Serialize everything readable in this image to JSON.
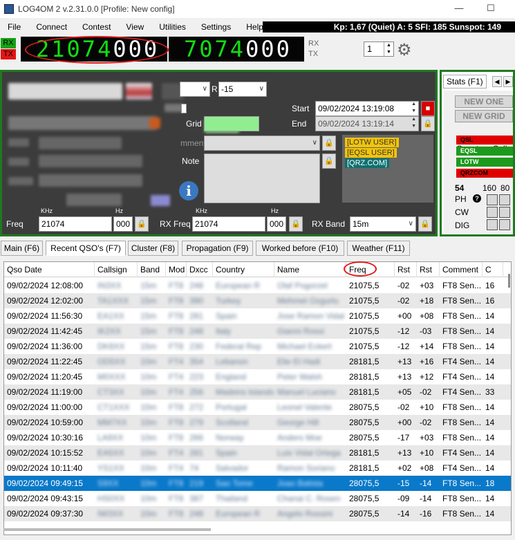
{
  "window": {
    "title": "LOG4OM 2 v.2.31.0.0 [Profile: New config]",
    "minimize": "—",
    "maximize": "☐"
  },
  "menu": [
    "File",
    "Connect",
    "Contest",
    "View",
    "Utilities",
    "Settings",
    "Help"
  ],
  "status_strip": "Kp: 1,67 (Quiet)  A: 5  SFI: 185 Sunspot: 149",
  "freq_display": {
    "rx_label": "RX",
    "tx_label": "TX",
    "main_digits": "21074",
    "main_small": "000",
    "main_ghost": "8.888.",
    "second_digits": "7074",
    "second_small": "000",
    "rx_side": "RX",
    "tx_side": "TX",
    "spinner_value": "1"
  },
  "qso": {
    "r_label": "R",
    "r_value": "-15",
    "start_label": "Start",
    "start_value": "09/02/2024 13:19:08",
    "end_label": "End",
    "end_value": "09/02/2024 13:19:14",
    "grid_label": "Grid",
    "comment_label": "mment",
    "note_label": "Note",
    "tags": [
      "[LOTW USER]",
      "[EQSL USER]",
      "[QRZ.COM]"
    ],
    "khz_label": "KHz",
    "hz_label": "Hz",
    "freq_label": "Freq",
    "freq_khz": "21074",
    "freq_hz": "000",
    "rxfreq_label": "RX Freq",
    "rxfreq_khz": "21074",
    "rxfreq_hz": "000",
    "rxband_label": "RX Band",
    "rxband_value": "15m",
    "info_icon_glyph": "i",
    "lock_glyph": "🔒"
  },
  "stats": {
    "tab_label": "Stats (F1)",
    "new_one": "NEW ONE",
    "new_grid": "NEW GRID",
    "country_call": "Country - Call",
    "rows": [
      {
        "label": "QSL",
        "color": "#e00000"
      },
      {
        "label": "EQSL",
        "color": "#1d9a1d"
      },
      {
        "label": "LOTW",
        "color": "#1d9a1d"
      },
      {
        "label": "QRZCOM",
        "color": "#e00000"
      }
    ],
    "count1": "54",
    "count2": "160",
    "count3": "80",
    "help_glyph": "?",
    "modes": [
      "PH",
      "CW",
      "DIG"
    ]
  },
  "tabs": [
    "Main (F6)",
    "Recent QSO's (F7)",
    "Cluster (F8)",
    "Propagation (F9)",
    "Worked before (F10)",
    "Weather (F11)"
  ],
  "grid": {
    "columns": [
      "Qso Date",
      "Callsign",
      "Band",
      "Mod",
      "Dxcc",
      "Country",
      "Name",
      "Freq",
      "Rst",
      "Rst",
      "Comment",
      "C"
    ],
    "rows": [
      {
        "date": "09/02/2024 12:08:00",
        "call": "IN3XX",
        "band": "15m",
        "mode": "FT8",
        "dxcc": "248",
        "country": "European R",
        "name": "Olaf Pogorzel",
        "freq": "21075,5",
        "rst_s": "-02",
        "rst_r": "+03",
        "comment": "FT8  Sen...",
        "c": "16"
      },
      {
        "date": "09/02/2024 12:02:00",
        "call": "TA1XXX",
        "band": "15m",
        "mode": "FT8",
        "dxcc": "390",
        "country": "Turkey",
        "name": "Mehmet Ozgurlu",
        "freq": "21075,5",
        "rst_s": "-02",
        "rst_r": "+18",
        "comment": "FT8  Sen...",
        "c": "16"
      },
      {
        "date": "09/02/2024 11:56:30",
        "call": "EA1XX",
        "band": "15m",
        "mode": "FT8",
        "dxcc": "281",
        "country": "Spain",
        "name": "Jose Ramon Vidal",
        "freq": "21075,5",
        "rst_s": "+00",
        "rst_r": "+08",
        "comment": "FT8  Sen...",
        "c": "14"
      },
      {
        "date": "09/02/2024 11:42:45",
        "call": "IK2XX",
        "band": "15m",
        "mode": "FT8",
        "dxcc": "248",
        "country": "Italy",
        "name": "Gianni Rossi",
        "freq": "21075,5",
        "rst_s": "-12",
        "rst_r": "-03",
        "comment": "FT8  Sen...",
        "c": "14"
      },
      {
        "date": "09/02/2024 11:36:00",
        "call": "DK8XX",
        "band": "15m",
        "mode": "FT8",
        "dxcc": "230",
        "country": "Federal Rep",
        "name": "Michael Eckert",
        "freq": "21075,5",
        "rst_s": "-12",
        "rst_r": "+14",
        "comment": "FT8  Sen...",
        "c": "14"
      },
      {
        "date": "09/02/2024 11:22:45",
        "call": "OD5XX",
        "band": "10m",
        "mode": "FT4",
        "dxcc": "354",
        "country": "Lebanon",
        "name": "Elie El Hadi",
        "freq": "28181,5",
        "rst_s": "+13",
        "rst_r": "+16",
        "comment": "FT4  Sen...",
        "c": "14"
      },
      {
        "date": "09/02/2024 11:20:45",
        "call": "M0XXX",
        "band": "10m",
        "mode": "FT4",
        "dxcc": "223",
        "country": "England",
        "name": "Peter Walsh",
        "freq": "28181,5",
        "rst_s": "+13",
        "rst_r": "+12",
        "comment": "FT4  Sen...",
        "c": "14"
      },
      {
        "date": "09/02/2024 11:19:00",
        "call": "CT3XX",
        "band": "10m",
        "mode": "FT4",
        "dxcc": "256",
        "country": "Madeira Islands",
        "name": "Manuel Luciano",
        "freq": "28181,5",
        "rst_s": "+05",
        "rst_r": "-02",
        "comment": "FT4  Sen...",
        "c": "33"
      },
      {
        "date": "09/02/2024 11:00:00",
        "call": "CT1XXX",
        "band": "10m",
        "mode": "FT8",
        "dxcc": "272",
        "country": "Portugal",
        "name": "Leonel Valente",
        "freq": "28075,5",
        "rst_s": "-02",
        "rst_r": "+10",
        "comment": "FT8  Sen...",
        "c": "14"
      },
      {
        "date": "09/02/2024 10:59:00",
        "call": "MM7XX",
        "band": "10m",
        "mode": "FT8",
        "dxcc": "279",
        "country": "Scotland",
        "name": "George Hill",
        "freq": "28075,5",
        "rst_s": "+00",
        "rst_r": "-02",
        "comment": "FT8  Sen...",
        "c": "14"
      },
      {
        "date": "09/02/2024 10:30:16",
        "call": "LA9XX",
        "band": "10m",
        "mode": "FT8",
        "dxcc": "266",
        "country": "Norway",
        "name": "Anders Moe",
        "freq": "28075,5",
        "rst_s": "-17",
        "rst_r": "+03",
        "comment": "FT8  Sen...",
        "c": "14"
      },
      {
        "date": "09/02/2024 10:15:52",
        "call": "EA5XX",
        "band": "10m",
        "mode": "FT4",
        "dxcc": "281",
        "country": "Spain",
        "name": "Luis Vidal Ortega",
        "freq": "28181,5",
        "rst_s": "+13",
        "rst_r": "+10",
        "comment": "FT4  Sen...",
        "c": "14"
      },
      {
        "date": "09/02/2024 10:11:40",
        "call": "YS1XX",
        "band": "10m",
        "mode": "FT4",
        "dxcc": "74",
        "country": "Salvador",
        "name": "Ramon Soriano",
        "freq": "28181,5",
        "rst_s": "+02",
        "rst_r": "+08",
        "comment": "FT4  Sen...",
        "c": "14"
      },
      {
        "date": "09/02/2024 09:49:15",
        "call": "S9XX",
        "band": "10m",
        "mode": "FT8",
        "dxcc": "219",
        "country": "Sao Tome",
        "name": "Joao Batista",
        "freq": "28075,5",
        "rst_s": "-15",
        "rst_r": "-14",
        "comment": "FT8  Sen...",
        "c": "18",
        "selected": true
      },
      {
        "date": "09/02/2024 09:43:15",
        "call": "HS0XX",
        "band": "10m",
        "mode": "FT8",
        "dxcc": "387",
        "country": "Thailand",
        "name": "Chanai C. Rosen",
        "freq": "28075,5",
        "rst_s": "-09",
        "rst_r": "-14",
        "comment": "FT8  Sen...",
        "c": "14"
      },
      {
        "date": "09/02/2024 09:37:30",
        "call": "IW3XX",
        "band": "10m",
        "mode": "FT8",
        "dxcc": "248",
        "country": "European R",
        "name": "Angelo Rossini",
        "freq": "28075,5",
        "rst_s": "-14",
        "rst_r": "-16",
        "comment": "FT8  Sen...",
        "c": "14"
      }
    ]
  }
}
